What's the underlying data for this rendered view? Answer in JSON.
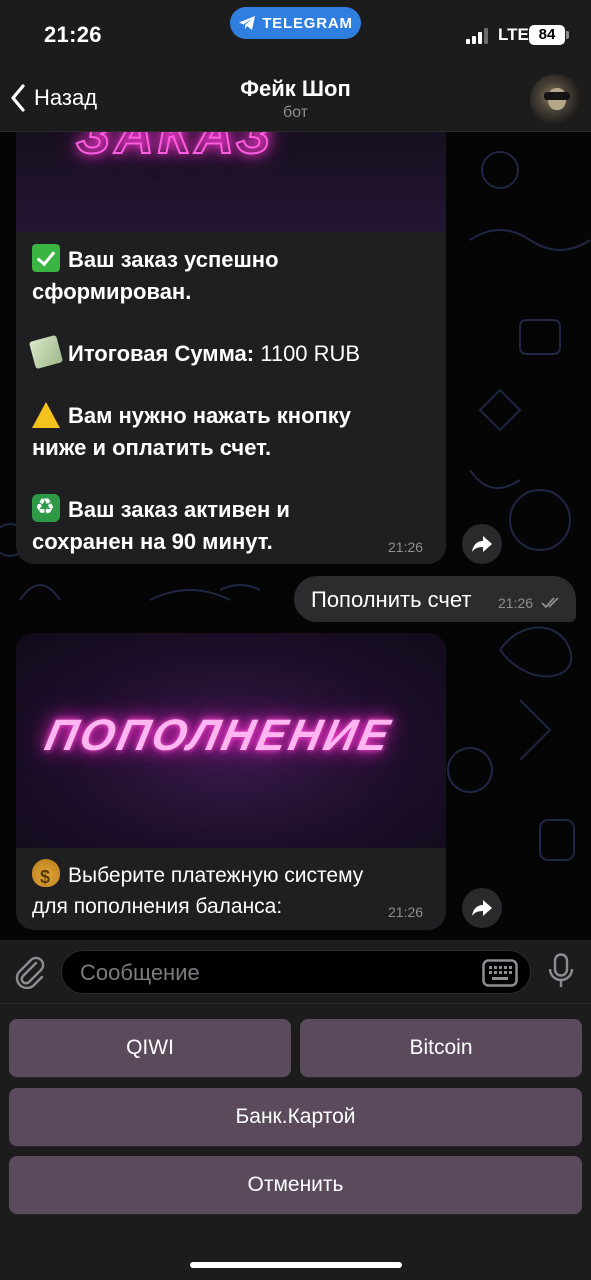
{
  "status_bar": {
    "time": "21:26",
    "app_pill": "TELEGRAM",
    "network": "LTE",
    "battery": "84"
  },
  "header": {
    "back_label": "Назад",
    "chat_title": "Фейк Шоп",
    "chat_subtitle": "бот"
  },
  "messages": [
    {
      "line1_bold": "Ваш заказ успешно",
      "line2_bold": "сформирован.",
      "sum_label": "Итоговая Сумма:",
      "sum_value": " 1100 RUB",
      "warn_line1": "Вам нужно нажать кнопку",
      "warn_line2": "ниже и оплатить счет.",
      "active_line1": "Ваш заказ активен и",
      "active_line2": "сохранен на 90 минут.",
      "time": "21:26"
    },
    {
      "text": "Пополнить счет",
      "time": "21:26"
    },
    {
      "banner_text": "ПОПОЛНЕНИЕ",
      "line1": "Выберите платежную систему",
      "line2": "для пополнения баланса:",
      "time": "21:26"
    }
  ],
  "input": {
    "placeholder": "Сообщение"
  },
  "keyboard": {
    "qiwi": "QIWI",
    "bitcoin": "Bitcoin",
    "card": "Банк.Картой",
    "cancel": "Отменить"
  },
  "icons": [
    "telegram-plane-icon",
    "signal-icon",
    "chevron-left-icon",
    "share-icon",
    "double-check-icon",
    "paperclip-icon",
    "keyboard-icon",
    "microphone-icon"
  ],
  "colors": {
    "accent_blue": "#2f7fe0",
    "bubble": "#1f1f21",
    "keyboard_button": "#5a4a5c",
    "neon_pink": "#ff4ed8"
  }
}
